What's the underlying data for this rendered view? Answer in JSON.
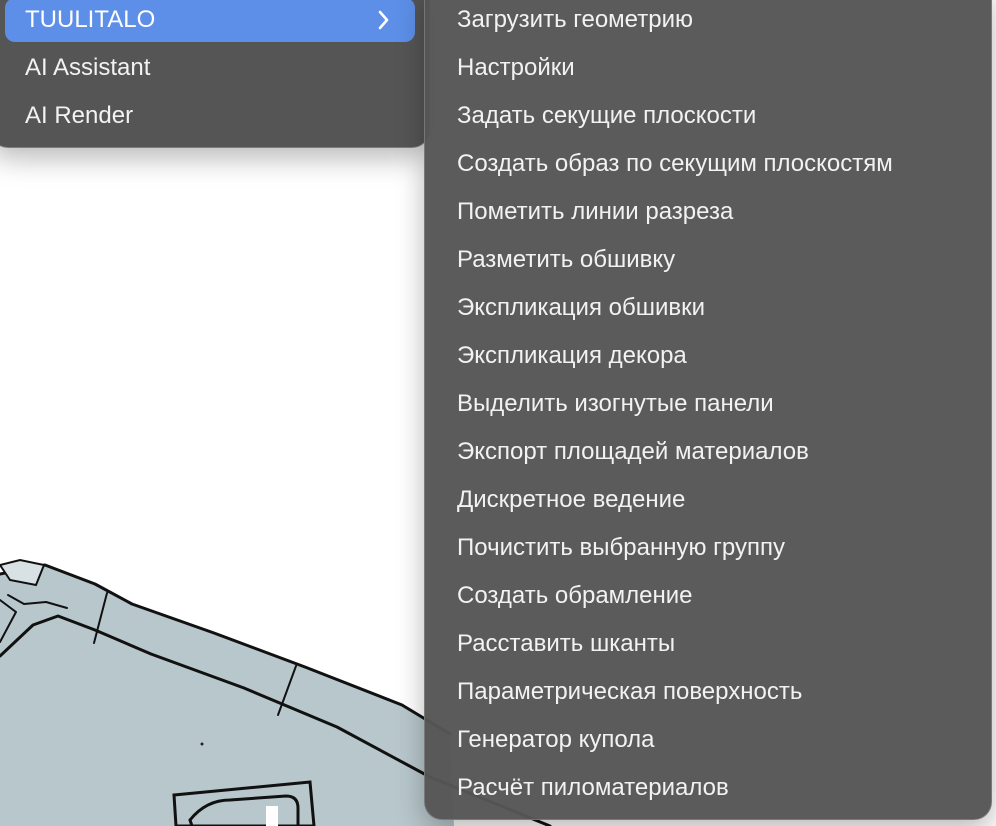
{
  "colors": {
    "menu_background": "#4e4e4e",
    "submenu_background": "#565656",
    "active_item": "#5d8fe8",
    "model_fill": "#b8c7cc",
    "canvas_background": "#ffffff"
  },
  "context_menu": {
    "items": [
      {
        "label": "TUULITALO",
        "active": true,
        "icon": "chevron-right-icon"
      },
      {
        "label": "AI Assistant"
      },
      {
        "label": "AI Render"
      }
    ]
  },
  "submenu": {
    "items": [
      {
        "label": "Загрузить геометрию"
      },
      {
        "label": "Настройки"
      },
      {
        "label": "Задать секущие плоскости"
      },
      {
        "label": "Создать образ по секущим плоскостям"
      },
      {
        "label": "Пометить линии разреза"
      },
      {
        "label": "Разметить обшивку"
      },
      {
        "label": "Экспликация обшивки"
      },
      {
        "label": "Экспликация декора"
      },
      {
        "label": "Выделить изогнутые панели"
      },
      {
        "label": "Экспорт площадей материалов"
      },
      {
        "label": "Дискретное ведение"
      },
      {
        "label": "Почистить выбранную группу"
      },
      {
        "label": "Создать обрамление"
      },
      {
        "label": "Расставить шканты"
      },
      {
        "label": "Параметрическая поверхность"
      },
      {
        "label": "Генератор купола"
      },
      {
        "label": "Расчёт пиломатериалов"
      }
    ]
  }
}
